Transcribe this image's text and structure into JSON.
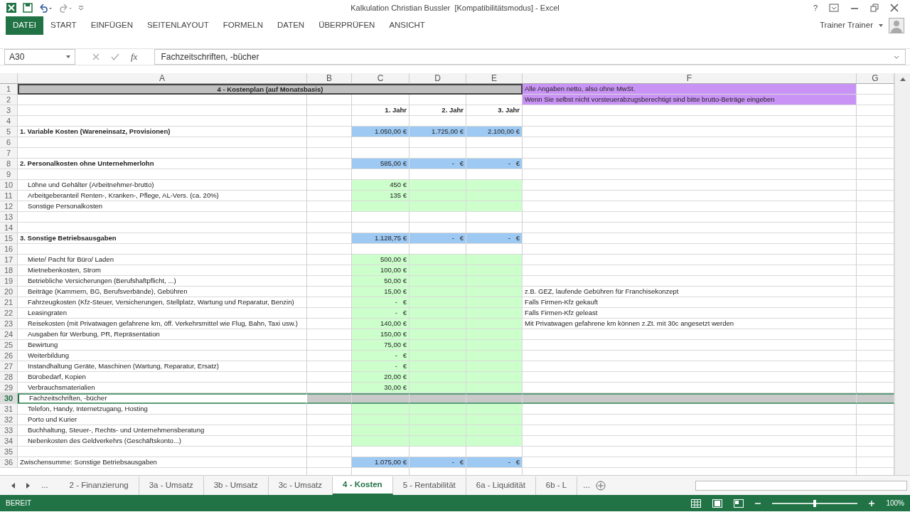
{
  "title_bar": {
    "title": "Kalkulation Christian Bussler  [Kompatibilitätsmodus] - Excel",
    "help": "?"
  },
  "ribbon": {
    "file_tab": "DATEI",
    "tabs": [
      "START",
      "EINFÜGEN",
      "SEITENLAYOUT",
      "FORMELN",
      "DATEN",
      "ÜBERPRÜFEN",
      "ANSICHT"
    ],
    "user": "Trainer Trainer"
  },
  "formula_bar": {
    "name_box": "A30",
    "function_label": "fx",
    "value": "Fachzeitschriften, -bücher"
  },
  "columns": [
    "A",
    "B",
    "C",
    "D",
    "E",
    "F",
    "G"
  ],
  "rows": [
    {
      "number": "1",
      "kind": "title",
      "selected": false,
      "a": "4 - Kostenplan (auf Monatsbasis)",
      "f": "Alle Angaben netto, also ohne MwSt."
    },
    {
      "number": "2",
      "kind": "note",
      "selected": false,
      "f": "Wenn Sie selbst nicht vorsteuerabzugsberechtigt sind bitte brutto-Beträge eingeben"
    },
    {
      "number": "3",
      "kind": "header",
      "selected": false,
      "c": "1. Jahr",
      "d": "2. Jahr",
      "e": "3. Jahr"
    },
    {
      "number": "4",
      "kind": "blank",
      "selected": false
    },
    {
      "number": "5",
      "kind": "total",
      "selected": false,
      "a": "1. Variable Kosten (Wareneinsatz, Provisionen)",
      "c": "1.050,00 €",
      "d": "1.725,00 €",
      "e": "2.100,00 €"
    },
    {
      "number": "6",
      "kind": "blank",
      "selected": false
    },
    {
      "number": "7",
      "kind": "blank",
      "selected": false
    },
    {
      "number": "8",
      "kind": "total",
      "selected": false,
      "a": "2. Personalkosten ohne Unternehmerlohn",
      "c": "585,00 €",
      "d": "-   €",
      "e": "-   €"
    },
    {
      "number": "9",
      "kind": "blank",
      "selected": false
    },
    {
      "number": "10",
      "kind": "input",
      "selected": false,
      "a": "Löhne und Gehälter (Arbeitnehmer-brutto)",
      "c": "450 €"
    },
    {
      "number": "11",
      "kind": "input",
      "selected": false,
      "a": "Arbeitgeberanteil Renten-, Kranken-, Pflege, AL-Vers. (ca. 20%)",
      "c": "135 €"
    },
    {
      "number": "12",
      "kind": "input",
      "selected": false,
      "a": "Sonstige Personalkosten"
    },
    {
      "number": "13",
      "kind": "blank",
      "selected": false
    },
    {
      "number": "14",
      "kind": "blank",
      "selected": false
    },
    {
      "number": "15",
      "kind": "total",
      "selected": false,
      "a": "3. Sonstige Betriebsausgaben",
      "c": "1.128,75 €",
      "d": "-   €",
      "e": "-   €"
    },
    {
      "number": "16",
      "kind": "blank",
      "selected": false
    },
    {
      "number": "17",
      "kind": "input",
      "selected": false,
      "a": "Miete/ Pacht für Büro/ Laden",
      "c": "500,00 €"
    },
    {
      "number": "18",
      "kind": "input",
      "selected": false,
      "a": "Mietnebenkosten, Strom",
      "c": "100,00 €"
    },
    {
      "number": "19",
      "kind": "input",
      "selected": false,
      "a": "Betriebliche Versicherungen (Berufshaftpflicht, ...)",
      "c": "50,00 €"
    },
    {
      "number": "20",
      "kind": "input",
      "selected": false,
      "a": "Beiträge (Kammern, BG, Berufsverbände), Gebühren",
      "c": "15,00 €",
      "f": "z.B. GEZ, laufende Gebühren für Franchisekonzept"
    },
    {
      "number": "21",
      "kind": "input",
      "selected": false,
      "a": "Fahrzeugkosten (Kfz-Steuer, Versicherungen, Stellplatz, Wartung und Reparatur, Benzin)",
      "c": "-   €",
      "f": "Falls Firmen-Kfz gekauft"
    },
    {
      "number": "22",
      "kind": "input",
      "selected": false,
      "a": "Leasingraten",
      "c": "-   €",
      "f": "Falls Firmen-Kfz geleast"
    },
    {
      "number": "23",
      "kind": "input",
      "selected": false,
      "a": "Reisekosten (mit Privatwagen gefahrene km, öff. Verkehrsmittel wie Flug, Bahn, Taxi usw.)",
      "c": "140,00 €",
      "f": "Mit Privatwagen gefahrene km können z.Zt. mit 30c angesetzt werden"
    },
    {
      "number": "24",
      "kind": "input",
      "selected": false,
      "a": "Ausgaben für Werbung, PR, Repräsentation",
      "c": "150,00 €"
    },
    {
      "number": "25",
      "kind": "input",
      "selected": false,
      "a": "Bewirtung",
      "c": "75,00 €"
    },
    {
      "number": "26",
      "kind": "input",
      "selected": false,
      "a": "Weiterbildung",
      "c": "-   €"
    },
    {
      "number": "27",
      "kind": "input",
      "selected": false,
      "a": "Instandhaltung Geräte, Maschinen (Wartung, Reparatur, Ersatz)",
      "c": "-   €"
    },
    {
      "number": "28",
      "kind": "input",
      "selected": false,
      "a": "Bürobedarf, Kopien",
      "c": "20,00 €"
    },
    {
      "number": "29",
      "kind": "input",
      "selected": false,
      "a": "Verbrauchsmaterialien",
      "c": "30,00 €"
    },
    {
      "number": "30",
      "kind": "input",
      "selected": true,
      "a": "Fachzeitschriften, -bücher"
    },
    {
      "number": "31",
      "kind": "input",
      "selected": false,
      "a": "Telefon, Handy, Internetzugang, Hosting"
    },
    {
      "number": "32",
      "kind": "input",
      "selected": false,
      "a": "Porto und Kurier"
    },
    {
      "number": "33",
      "kind": "input",
      "selected": false,
      "a": "Buchhaltung, Steuer-, Rechts- und Unternehmensberatung"
    },
    {
      "number": "34",
      "kind": "input",
      "selected": false,
      "a": "Nebenkosten des Geldverkehrs (Geschäftskonto...)"
    },
    {
      "number": "35",
      "kind": "blank",
      "selected": false
    },
    {
      "number": "36",
      "kind": "subtotal",
      "selected": false,
      "a": "Zwischensumme: Sonstige Betriebsausgaben",
      "c": "1.075,00 €",
      "d": "-   €",
      "e": "-   €"
    }
  ],
  "sheet_tabs": {
    "more_left": "...",
    "tabs": [
      {
        "label": "2 - Finanzierung",
        "selected": false
      },
      {
        "label": "3a - Umsatz",
        "selected": false
      },
      {
        "label": "3b - Umsatz",
        "selected": false
      },
      {
        "label": "3c - Umsatz",
        "selected": false
      },
      {
        "label": "4 - Kosten",
        "selected": true
      },
      {
        "label": "5 - Rentabilität",
        "selected": false
      },
      {
        "label": "6a - Liquidität",
        "selected": false
      },
      {
        "label": "6b - L",
        "selected": false
      }
    ],
    "more_right": "..."
  },
  "status_bar": {
    "mode": "BEREIT",
    "zoom": "100%",
    "zoom_slider": {
      "level": 0.5
    }
  }
}
